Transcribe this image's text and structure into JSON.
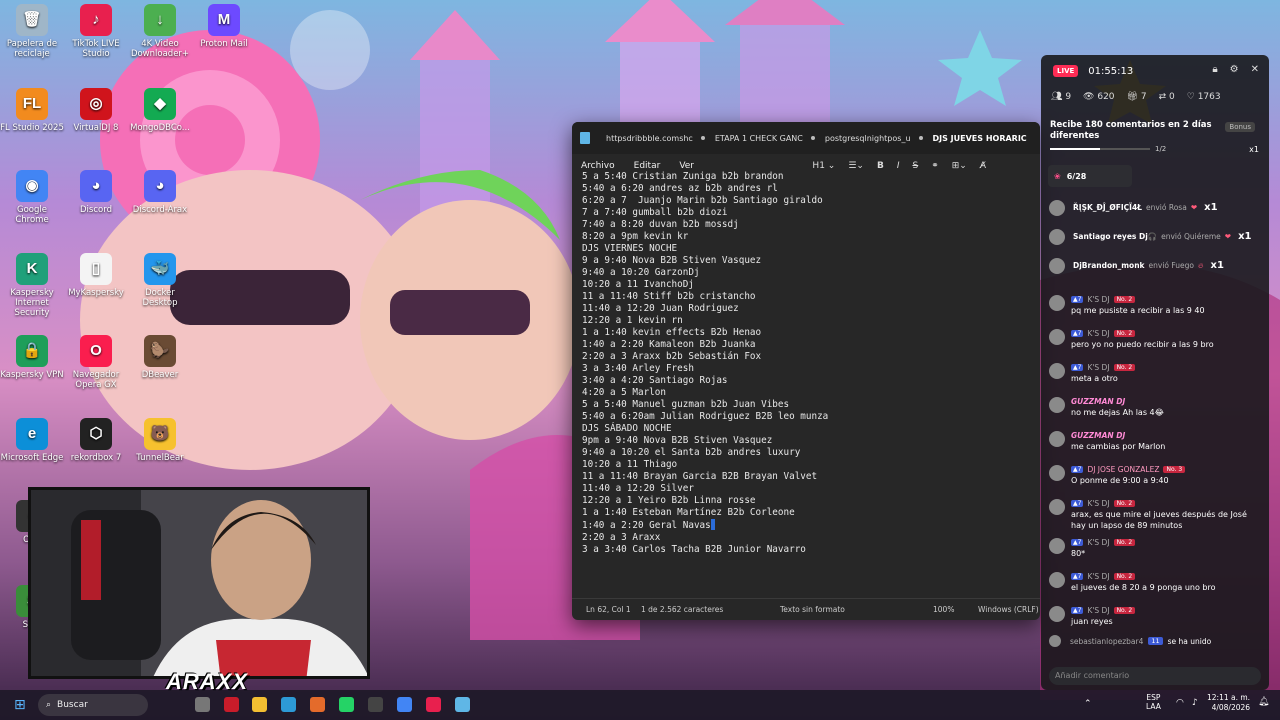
{
  "desktop": {
    "icons": [
      {
        "label": "Papelera de reciclaje",
        "glyph": "🗑",
        "color": "#9fb6c8"
      },
      {
        "label": "TikTok LIVE Studio",
        "glyph": "♪",
        "color": "#e8204e"
      },
      {
        "label": "4K Video Downloader+",
        "glyph": "↓",
        "color": "#4caf50"
      },
      {
        "label": "Proton Mail",
        "glyph": "M",
        "color": "#6d4aff"
      },
      {
        "label": "FL Studio 2025",
        "glyph": "FL",
        "color": "#f28b1e"
      },
      {
        "label": "VirtualDJ 8",
        "glyph": "◎",
        "color": "#d0141c"
      },
      {
        "label": "MongoDBCo...",
        "glyph": "◆",
        "color": "#13aa52"
      },
      {
        "label": "Google Chrome",
        "glyph": "◉",
        "color": "#4285f4"
      },
      {
        "label": "Discord",
        "glyph": "◕",
        "color": "#5865f2"
      },
      {
        "label": "Discord-Arax",
        "glyph": "◕",
        "color": "#5865f2"
      },
      {
        "label": "Kaspersky Internet Security",
        "glyph": "K",
        "color": "#20a07a"
      },
      {
        "label": "MyKaspersky",
        "glyph": "▯",
        "color": "#f4f4f4"
      },
      {
        "label": "Docker Desktop",
        "glyph": "🐳",
        "color": "#2496ed"
      },
      {
        "label": "Kaspersky VPN",
        "glyph": "🔒",
        "color": "#1e9e5a"
      },
      {
        "label": "Navegador Opera GX",
        "glyph": "O",
        "color": "#fa1e4e"
      },
      {
        "label": "DBeaver",
        "glyph": "🦫",
        "color": "#6a4b34"
      },
      {
        "label": "Microsoft Edge",
        "glyph": "e",
        "color": "#0c8fd8"
      },
      {
        "label": "rekordbox 7",
        "glyph": "⬡",
        "color": "#222222"
      },
      {
        "label": "TunnelBear",
        "glyph": "🐻",
        "color": "#f6c12e"
      },
      {
        "label": "OBS",
        "glyph": "●",
        "color": "#333333"
      },
      {
        "label": "Safe",
        "glyph": "S",
        "color": "#3a8d3a"
      }
    ]
  },
  "overlay": {
    "watermark": "ARAXX"
  },
  "editor": {
    "tabs": [
      "httpsdribbble.comshc",
      "ETAPA 1 CHECK GANC",
      "postgresqlnightpos_u",
      "DJS JUEVES HORARIC"
    ],
    "active_tab": 3,
    "menu": [
      "Archivo",
      "Editar",
      "Ver"
    ],
    "tools": {
      "heading": "H1",
      "bold": "B",
      "italic": "I",
      "strike": "S"
    },
    "lines": [
      "5 a 5:40 Cristian Zuniga b2b brandon",
      "5:40 a 6:20 andres az b2b andres rl",
      "6:20 a 7  Juanjo Marin b2b Santiago giraldo",
      "7 a 7:40 gumball b2b diozi",
      "7:40 a 8:20 duvan b2b mossdj",
      "8:20 a 9pm kevin kr",
      "",
      "",
      "DJS VIERNES NOCHE",
      "",
      "9 a 9:40 Nova B2B Stiven Vasquez",
      "9:40 a 10:20 GarzonDj",
      "10:20 a 11 IvanchoDj",
      "11 a 11:40 Stiff b2b cristancho",
      "11:40 a 12:20 Juan Rodriguez",
      "12:20 a 1 kevin rn",
      "1 a 1:40 kevin effects B2b Henao",
      "1:40 a 2:20 Kamaleon B2b Juanka",
      "2:20 a 3 Araxx b2b Sebastián Fox",
      "3 a 3:40 Arley Fresh",
      "3:40 a 4:20 Santiago Rojas",
      "4:20 a 5 Marlon",
      "5 a 5:40 Manuel guzman b2b Juan Vibes",
      "5:40 a 6:20am Julian Rodriguez B2B leo munza",
      "",
      "DJS SÁBADO NOCHE",
      "9pm a 9:40 Nova B2B Stiven Vasquez",
      "9:40 a 10:20 el Santa b2b andres luxury",
      "10:20 a 11 Thiago",
      "11 a 11:40 Brayan Garcia B2B Brayan Valvet",
      "11:40 a 12:20 Silver",
      "12:20 a 1 Yeiro B2b Linna rosse",
      "1 a 1:40 Esteban Martínez B2b Corleone",
      "1:40 a 2:20 Geral Navas",
      "2:20 a 3 Araxx",
      "3 a 3:40 Carlos Tacha B2B Junior Navarro"
    ],
    "status": {
      "position": "Ln 62, Col 1",
      "chars": "1 de 2.562 caracteres",
      "format": "Texto sin formato",
      "zoom": "100%",
      "eol": "Windows (CRLF)"
    }
  },
  "live": {
    "badge": "LIVE",
    "timer": "01:55:13",
    "stats": {
      "viewers_icon": "9",
      "views": "620",
      "gifts": "7",
      "shares": "0",
      "likes": "1763"
    },
    "goal": {
      "text": "Recibe 180 comentarios en 2 días diferentes",
      "bonus": "Bonus",
      "progress": "1/2",
      "multiplier": "x1",
      "fill": 0.5
    },
    "counter": "6/28",
    "gifts": [
      {
        "user": "ŘĮŞK_ĐĴ_ØFIÇÏ4Ł",
        "action": "envió Rosa",
        "count": "x1"
      },
      {
        "user": "Santiago reyes Dj🎧",
        "action": "envió Quiéreme",
        "count": "x1"
      },
      {
        "user": "DjBrandon_monk",
        "action": "envió Fuego",
        "count": "x1"
      }
    ],
    "comments": [
      {
        "user": "K'S DJ",
        "lvl": "No. 2",
        "text": "pq me pusiste a recibir a las 9 40",
        "style": "normal"
      },
      {
        "user": "K'S DJ",
        "lvl": "No. 2",
        "text": "pero yo no puedo recibir a las 9 bro",
        "style": "normal"
      },
      {
        "user": "K'S DJ",
        "lvl": "No. 2",
        "text": "meta a otro",
        "style": "normal"
      },
      {
        "user": "GUZZMAN DJ",
        "lvl": "",
        "text": "no me dejas Ah las 4😂",
        "style": "guzzman"
      },
      {
        "user": "GUZZMAN DJ",
        "lvl": "",
        "text": "me cambias por Marlon",
        "style": "guzzman"
      },
      {
        "user": "DJ JOSE GONZALEZ",
        "lvl": "No. 3",
        "text": "O ponme de 9:00 a 9:40",
        "style": "jose"
      },
      {
        "user": "K'S DJ",
        "lvl": "No. 2",
        "text": "arax, es que mire el jueves después de José hay un lapso de 89 minutos",
        "style": "normal"
      },
      {
        "user": "K'S DJ",
        "lvl": "No. 2",
        "text": "80*",
        "style": "normal"
      },
      {
        "user": "K'S DJ",
        "lvl": "No. 2",
        "text": "el jueves de 8 20 a 9 ponga uno bro",
        "style": "normal"
      },
      {
        "user": "K'S DJ",
        "lvl": "No. 2",
        "text": "juan reyes",
        "style": "normal"
      }
    ],
    "joined": {
      "user": "sebastianlopezbar4",
      "level": "11",
      "text": "se ha unido"
    },
    "input_placeholder": "Añadir comentario"
  },
  "taskbar": {
    "search": "Buscar",
    "lang": "ESP",
    "lang2": "LAA",
    "time": "12:11 a. m.",
    "date": "4/08/2026"
  }
}
